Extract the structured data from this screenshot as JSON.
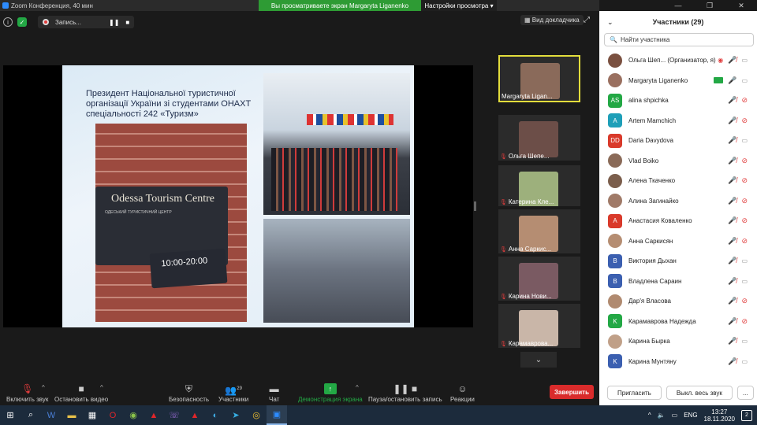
{
  "window": {
    "title": "Zoom Конференция, 40 мин"
  },
  "banner": {
    "message": "Вы просматриваете экран Margaryta Liganenko",
    "options": "Настройки просмотра ▾"
  },
  "topbar": {
    "record_label": "Запись...",
    "view_button": "Вид докладчика"
  },
  "slide": {
    "title": "Президент Національної туристичної організації України зі студентами ОНАХТ спеціальності 242 «Туризм»",
    "sign_name": "Odessa Tourism Centre",
    "sign_sub": "ОДЕСЬКИЙ ТУРИСТИЧНИЙ ЦЕНТР",
    "hours": "10:00-20:00"
  },
  "thumbnails": [
    {
      "name": "Margaryta Ligan...",
      "mic_muted": false,
      "color": "#8a6a5a",
      "active": true
    },
    {
      "name": "Ольга Шепе...",
      "mic_muted": true,
      "color": "#6c4e48",
      "active": false
    },
    {
      "name": "Катерина Кле...",
      "mic_muted": true,
      "color": "#9db07c",
      "active": false
    },
    {
      "name": "Анна Саркис...",
      "mic_muted": true,
      "color": "#b58d72",
      "active": false
    },
    {
      "name": "Карина Нови...",
      "mic_muted": true,
      "color": "#7a5a62",
      "active": false
    },
    {
      "name": "Карамаврова...",
      "mic_muted": true,
      "color": "#c9b6a8",
      "active": false
    }
  ],
  "toolbar": {
    "mic": "Включить звук",
    "video": "Остановить видео",
    "security": "Безопасность",
    "participants": "Участники",
    "participants_count": "29",
    "chat": "Чат",
    "share": "Демонстрация экрана",
    "pause_rec": "Пауза/остановить запись",
    "reactions": "Реакции",
    "end": "Завершить"
  },
  "panel": {
    "title": "Участники (29)",
    "search_placeholder": "Найти участника",
    "invite": "Пригласить",
    "mute_all": "Выкл. весь звук",
    "more": "...",
    "participants": [
      {
        "initials": "",
        "name": "Ольга Шеп... (Организатор, я)",
        "color": "#7a5040",
        "photo": true,
        "mic": "rec",
        "cam": "on"
      },
      {
        "initials": "",
        "name": "Margaryta Liganenko",
        "color": "#9a7060",
        "photo": true,
        "mic": "on",
        "cam": "on",
        "sharing": true
      },
      {
        "initials": "AS",
        "name": "alina shpichka",
        "color": "#23a845",
        "photo": false,
        "mic": "off",
        "cam": "off"
      },
      {
        "initials": "A",
        "name": "Artem Mamchich",
        "color": "#1e9fb8",
        "photo": false,
        "mic": "off",
        "cam": "off"
      },
      {
        "initials": "DD",
        "name": "Daria Davydova",
        "color": "#d93a2b",
        "photo": false,
        "mic": "off",
        "cam": "on"
      },
      {
        "initials": "",
        "name": "Vlad Boiko",
        "color": "#8a6a58",
        "photo": true,
        "mic": "off",
        "cam": "off"
      },
      {
        "initials": "",
        "name": "Алена Ткаченко",
        "color": "#7b5e4c",
        "photo": true,
        "mic": "off",
        "cam": "off"
      },
      {
        "initials": "",
        "name": "Алина Загинайко",
        "color": "#a07a68",
        "photo": true,
        "mic": "off",
        "cam": "off"
      },
      {
        "initials": "A",
        "name": "Анастасия Коваленко",
        "color": "#d93a2b",
        "photo": false,
        "mic": "off",
        "cam": "off"
      },
      {
        "initials": "",
        "name": "Анна Саркисян",
        "color": "#b58d72",
        "photo": true,
        "mic": "off",
        "cam": "off"
      },
      {
        "initials": "B",
        "name": "Виктория Дыхан",
        "color": "#3b5fb0",
        "photo": false,
        "mic": "off",
        "cam": "on"
      },
      {
        "initials": "B",
        "name": "Владлена Сараин",
        "color": "#3b5fb0",
        "photo": false,
        "mic": "off",
        "cam": "on"
      },
      {
        "initials": "",
        "name": "Дар'я Власова",
        "color": "#b08a70",
        "photo": true,
        "mic": "off",
        "cam": "off"
      },
      {
        "initials": "K",
        "name": "Карамаврова Надежда",
        "color": "#23a845",
        "photo": false,
        "mic": "off",
        "cam": "off"
      },
      {
        "initials": "",
        "name": "Карина Бырка",
        "color": "#c0a088",
        "photo": true,
        "mic": "off",
        "cam": "on"
      },
      {
        "initials": "K",
        "name": "Карина Мунтяну",
        "color": "#3b5fb0",
        "photo": false,
        "mic": "off",
        "cam": "on"
      }
    ]
  },
  "taskbar": {
    "lang": "ENG",
    "time": "13:27",
    "date": "18.11.2020",
    "notifications": "2"
  }
}
